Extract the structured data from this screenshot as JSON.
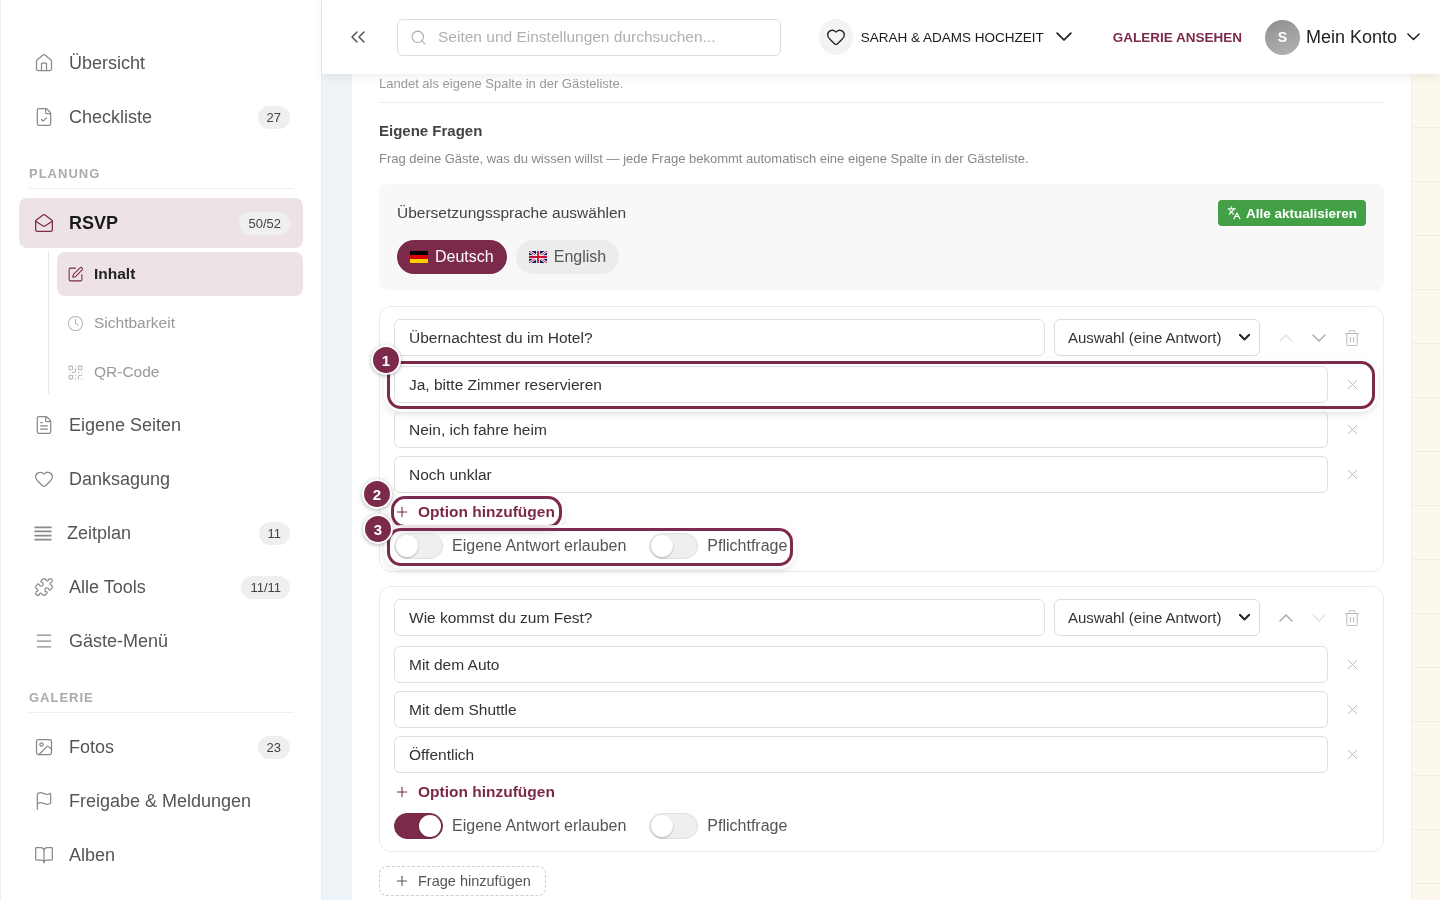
{
  "sidebar": {
    "groups": [
      {
        "items": [
          {
            "label": "Übersicht",
            "selected": false
          },
          {
            "label": "Checkliste",
            "badge": "27",
            "selected": false
          }
        ]
      },
      {
        "heading": "PLANUNG",
        "items": [
          {
            "label": "RSVP",
            "badge": "50/52",
            "selected": true,
            "children": [
              {
                "label": "Inhalt",
                "selected": true
              },
              {
                "label": "Sichtbarkeit",
                "selected": false
              },
              {
                "label": "QR-Code",
                "selected": false
              }
            ]
          },
          {
            "label": "Eigene Seiten",
            "selected": false
          },
          {
            "label": "Danksagung",
            "selected": false
          },
          {
            "label": "Zeitplan",
            "badge": "11",
            "selected": false
          },
          {
            "label": "Alle Tools",
            "badge": "11/11",
            "selected": false
          },
          {
            "label": "Gäste-Menü",
            "selected": false
          }
        ]
      },
      {
        "heading": "GALERIE",
        "items": [
          {
            "label": "Fotos",
            "badge": "23",
            "selected": false
          },
          {
            "label": "Freigabe & Meldungen",
            "selected": false
          },
          {
            "label": "Alben",
            "selected": false
          }
        ]
      }
    ]
  },
  "header": {
    "search": {
      "placeholder": "Seiten und Einstellungen durchsuchen..."
    },
    "event": "SARAH & ADAMS HOCHZEIT",
    "gallery_link": "GALERIE ANSEHEN",
    "account": {
      "initial": "S",
      "label": "Mein Konto"
    }
  },
  "content": {
    "note": "Landet als eigene Spalte in der Gästeliste.",
    "section": {
      "title": "Eigene Fragen",
      "description": "Frag deine Gäste, was du wissen willst — jede Frage bekommt automatisch eine eigene Spalte in der Gästeliste."
    },
    "translation": {
      "title": "Übersetzungssprache auswählen",
      "update_button": "Alle aktualisieren",
      "languages": [
        {
          "label": "Deutsch",
          "selected": true
        },
        {
          "label": "English",
          "selected": false
        }
      ]
    },
    "questions": [
      {
        "question": "Übernachtest du im Hotel?",
        "type": "Auswahl (eine Antwort)",
        "up_disabled": true,
        "down_disabled": false,
        "options": [
          {
            "text": "Ja, bitte Zimmer reservieren",
            "callout": "1"
          },
          {
            "text": "Nein, ich fahre heim"
          },
          {
            "text": "Noch unklar"
          }
        ],
        "add_option": {
          "label": "Option hinzufügen",
          "callout": "2"
        },
        "toggles_callout": "3",
        "toggles": [
          {
            "label": "Eigene Antwort erlauben",
            "on": false
          },
          {
            "label": "Pflichtfrage",
            "on": false
          }
        ]
      },
      {
        "question": "Wie kommst du zum Fest?",
        "type": "Auswahl (eine Antwort)",
        "up_disabled": false,
        "down_disabled": true,
        "options": [
          {
            "text": "Mit dem Auto"
          },
          {
            "text": "Mit dem Shuttle"
          },
          {
            "text": "Öffentlich"
          }
        ],
        "add_option": {
          "label": "Option hinzufügen"
        },
        "toggles": [
          {
            "label": "Eigene Antwort erlauben",
            "on": true
          },
          {
            "label": "Pflichtfrage",
            "on": false
          }
        ]
      }
    ],
    "add_question": "Frage hinzufügen"
  }
}
